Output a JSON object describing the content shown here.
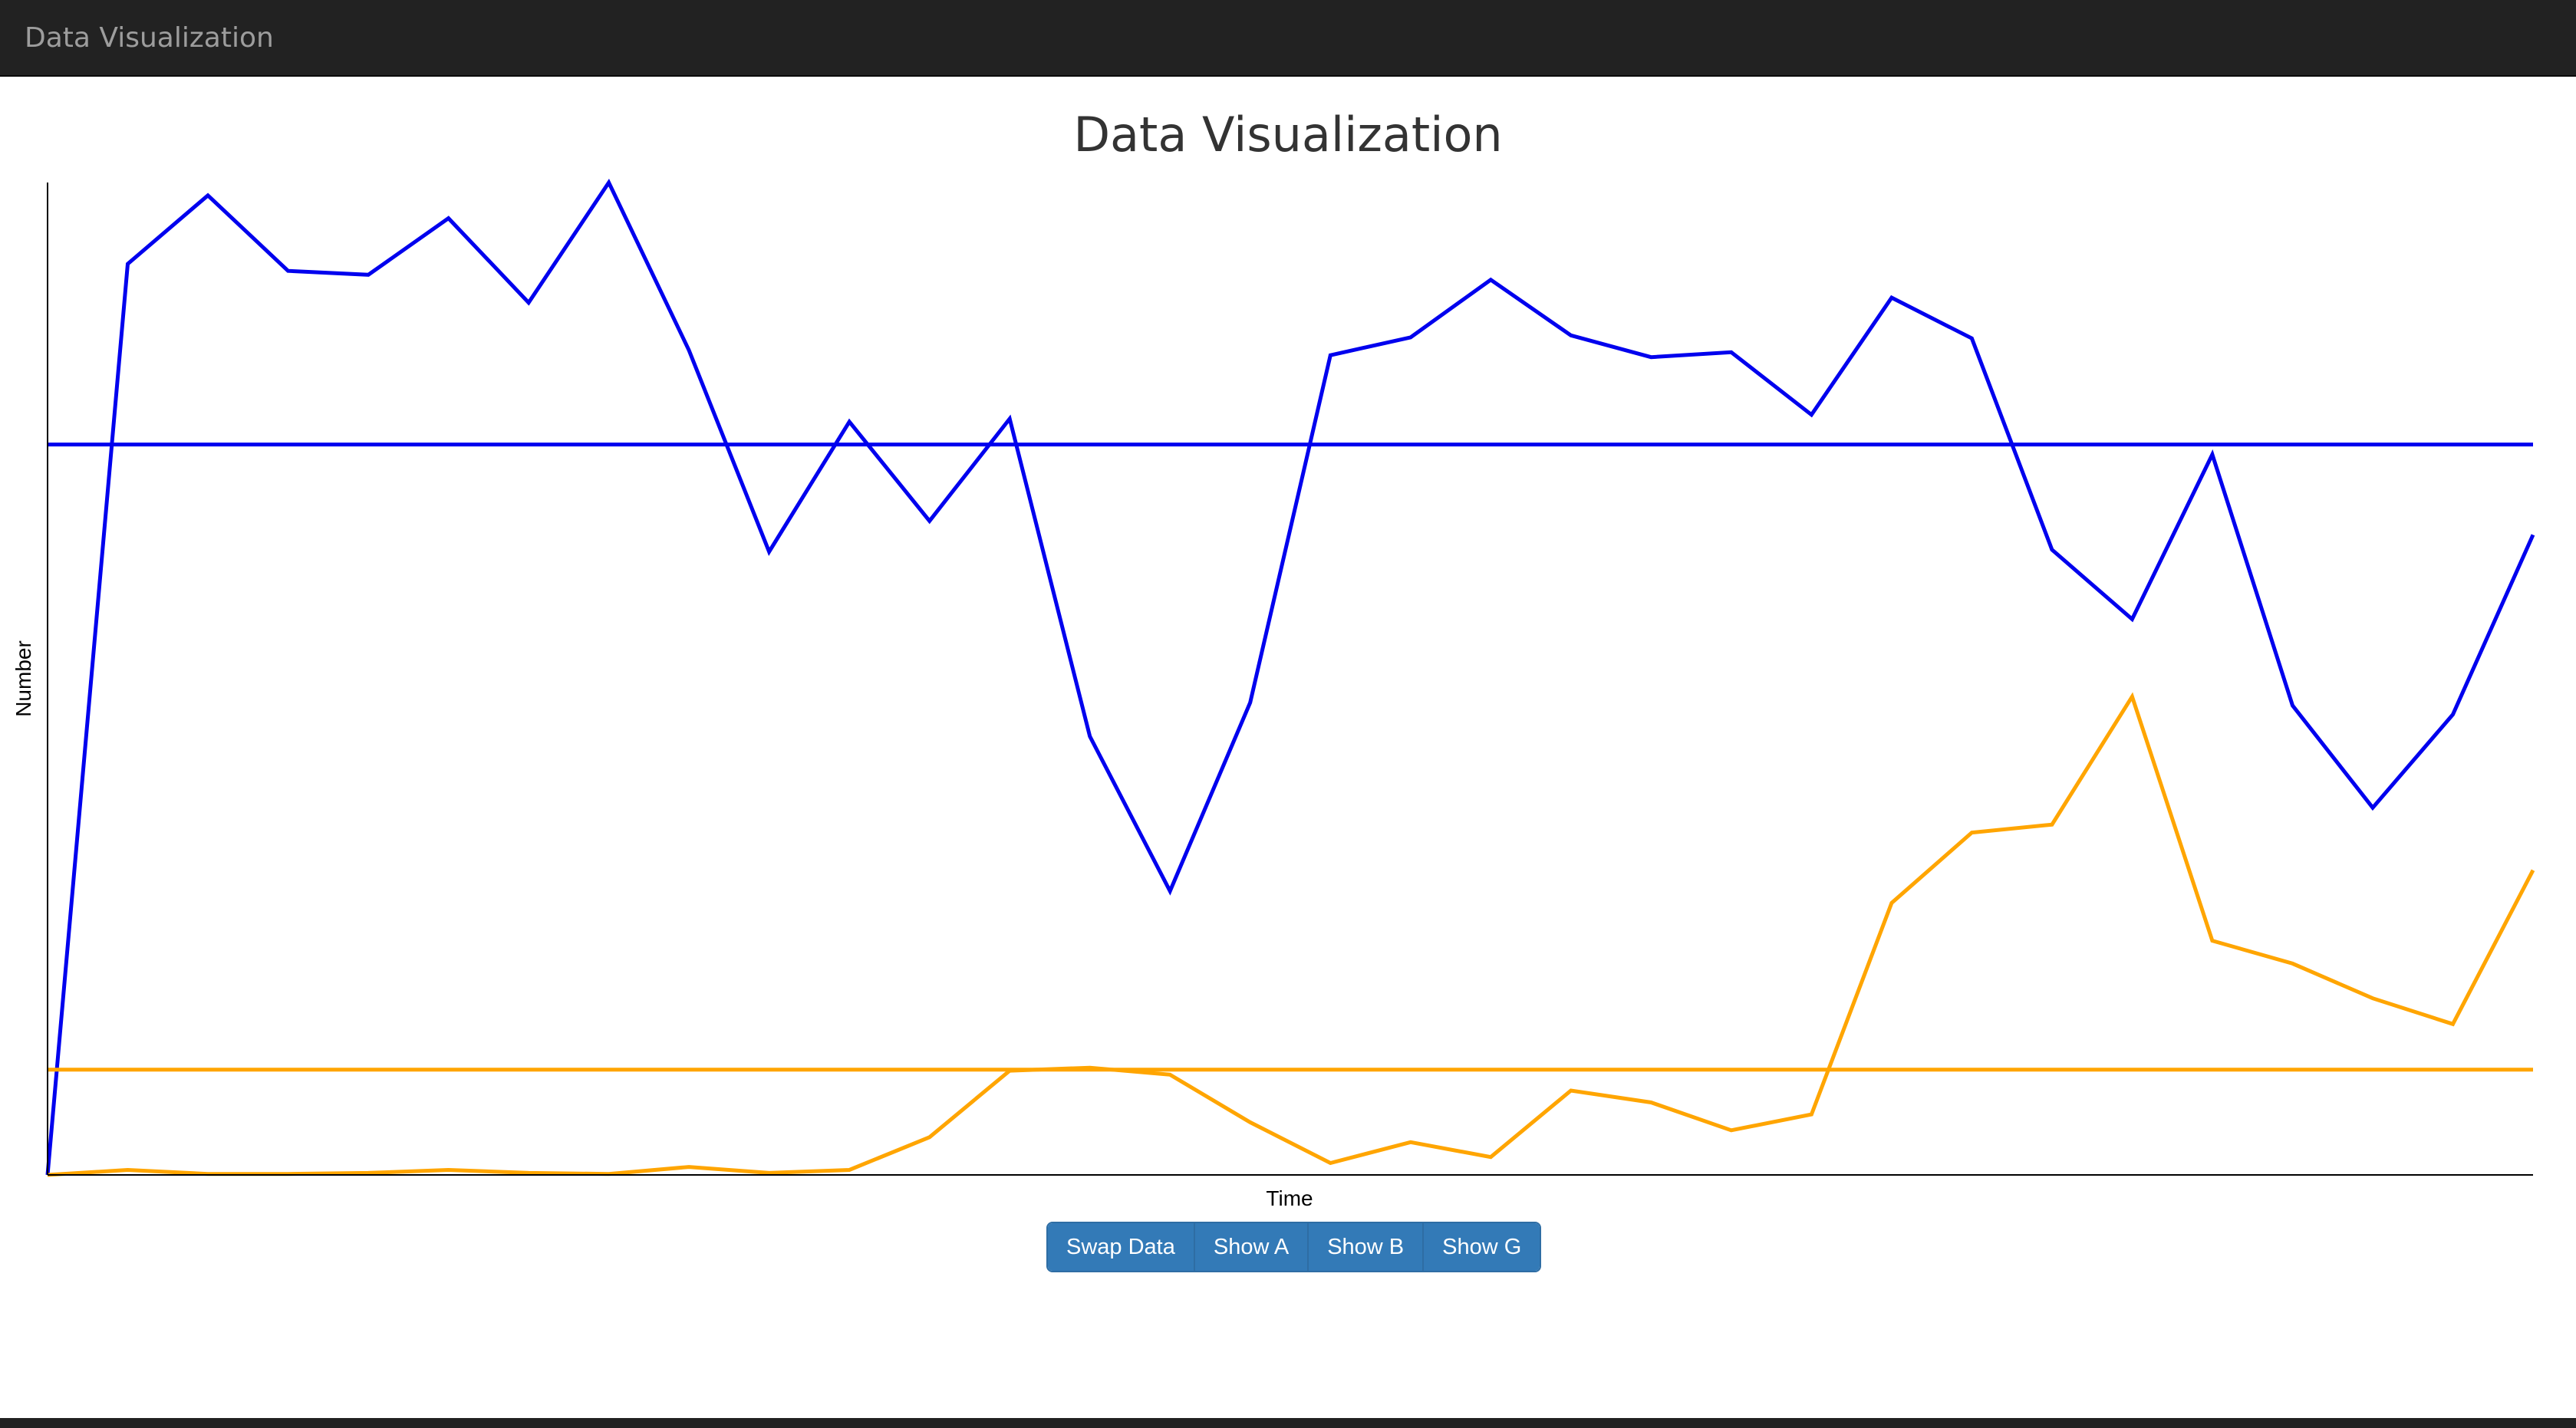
{
  "navbar": {
    "brand": "Data Visualization"
  },
  "page": {
    "title": "Data Visualization"
  },
  "buttons": [
    {
      "label": "Swap Data"
    },
    {
      "label": "Show A"
    },
    {
      "label": "Show B"
    },
    {
      "label": "Show G"
    }
  ],
  "chart_data": {
    "type": "line",
    "title": "Data Visualization",
    "xlabel": "Time",
    "ylabel": "Number",
    "x": [
      0,
      1,
      2,
      3,
      4,
      5,
      6,
      7,
      8,
      9,
      10,
      11,
      12,
      13,
      14,
      15,
      16,
      17,
      18,
      19,
      20,
      21,
      22,
      23,
      24,
      25,
      26,
      27,
      28,
      29,
      30,
      31
    ],
    "ylim": [
      0,
      100
    ],
    "xlim": [
      0,
      31
    ],
    "grid": false,
    "legend": "none",
    "series": [
      {
        "color": "#0000ee",
        "values": [
          0,
          91.8,
          98.7,
          91.1,
          90.7,
          96.4,
          87.9,
          100,
          83.1,
          62.8,
          75.9,
          65.9,
          76.2,
          44.2,
          28.6,
          47.6,
          82.6,
          84.4,
          90.2,
          84.6,
          82.4,
          82.9,
          76.6,
          88.4,
          84.3,
          63.0,
          56.0,
          72.6,
          47.3,
          37.0,
          46.4,
          64.5
        ]
      },
      {
        "color": "#ffa500",
        "values": [
          0,
          0.5,
          0.1,
          0.1,
          0.2,
          0.5,
          0.2,
          0.1,
          0.8,
          0.2,
          0.5,
          3.8,
          10.5,
          10.8,
          10.1,
          5.3,
          1.2,
          3.3,
          1.8,
          8.5,
          7.3,
          4.5,
          6.1,
          27.4,
          34.5,
          35.3,
          48.2,
          23.6,
          21.3,
          17.8,
          15.2,
          30.7
        ]
      },
      {
        "color": "#0000ee",
        "style": "reference",
        "values": [
          73.6,
          73.6
        ]
      },
      {
        "color": "#ffa500",
        "style": "reference",
        "values": [
          10.6,
          10.6
        ]
      }
    ]
  }
}
